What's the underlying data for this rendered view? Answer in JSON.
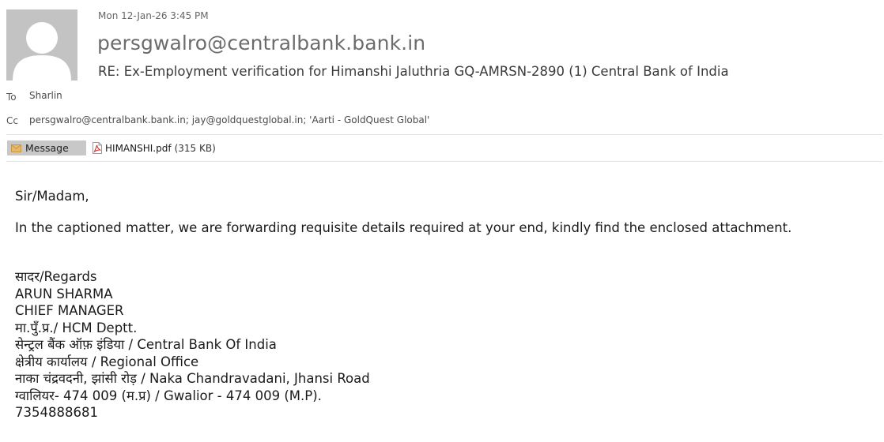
{
  "email": {
    "date": "Mon 12-Jan-26 3:45 PM",
    "sender": "persgwalro@centralbank.bank.in",
    "subject": "RE: Ex-Employment verification for Himanshi Jaluthria GQ-AMRSN-2890 (1) Central Bank of India",
    "to_label": "To",
    "to_value": "Sharlin",
    "cc_label": "Cc",
    "cc_value": "persgwalro@centralbank.bank.in; jay@goldquestglobal.in; 'Aarti - GoldQuest Global'"
  },
  "tabs": {
    "message_label": "Message",
    "message_icon": "envelope-icon",
    "attachment_name": "HIMANSHI.pdf",
    "attachment_size": "(315 KB)",
    "attachment_icon": "pdf-file-icon"
  },
  "body": {
    "greeting": "Sir/Madam,",
    "paragraph": "In the captioned matter, we are forwarding requisite details required at your end, kindly find the enclosed attachment.",
    "signature": [
      "सादर/Regards",
      "ARUN SHARMA",
      "CHIEF MANAGER",
      "मा.पुँ.प्र./ HCM Deptt.",
      "सेन्ट्रल बैंक ऑफ़ इंडिया / Central Bank Of India",
      "क्षेत्रीय कार्यालय / Regional Office",
      "नाका चंद्रवदनी, झांसी रोड़  / Naka Chandravadani, Jhansi Road",
      "ग्वालियर- 474 009 (म.प्र) / Gwalior - 474 009 (M.P).",
      "7354888681"
    ]
  },
  "colors": {
    "avatar_bg": "#c3c3c3",
    "sender_text": "#6c6c6c",
    "message_tab_bg": "#c8c8c8",
    "envelope": "#e8b96a",
    "pdf_red": "#d0312d"
  }
}
